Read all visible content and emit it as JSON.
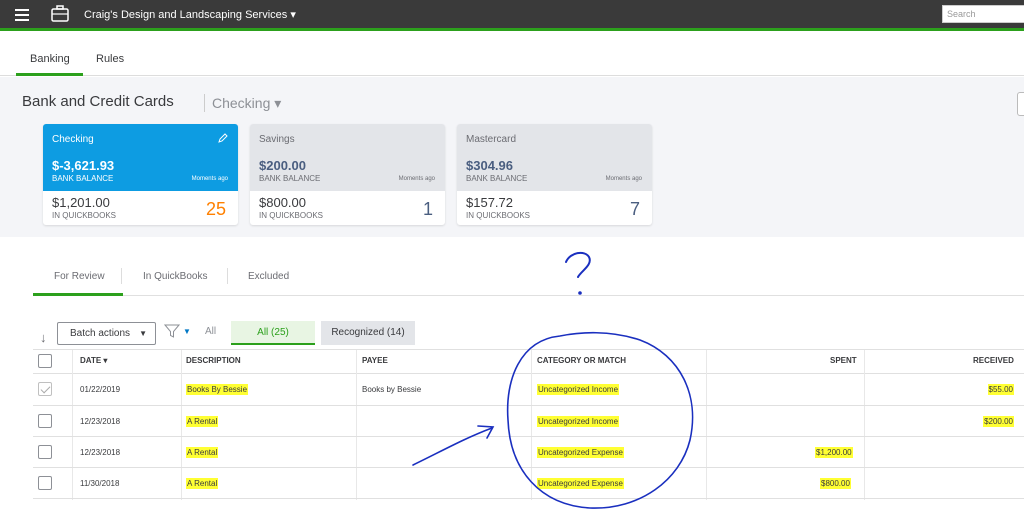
{
  "topbar": {
    "company": "Craig's Design and Landscaping Services ▾",
    "search_placeholder": "Search"
  },
  "subtabs": [
    {
      "label": "Banking"
    },
    {
      "label": "Rules"
    }
  ],
  "page": {
    "title": "Bank and Credit Cards",
    "account": "Checking ▾"
  },
  "cards": [
    {
      "name": "Checking",
      "bank_balance": "$-3,621.93",
      "bank_label": "BANK BALANCE",
      "moments": "Moments ago",
      "qb_balance": "$1,201.00",
      "qb_label": "IN QUICKBOOKS",
      "count": "25"
    },
    {
      "name": "Savings",
      "bank_balance": "$200.00",
      "bank_label": "BANK BALANCE",
      "moments": "Moments ago",
      "qb_balance": "$800.00",
      "qb_label": "IN QUICKBOOKS",
      "count": "1"
    },
    {
      "name": "Mastercard",
      "bank_balance": "$304.96",
      "bank_label": "BANK BALANCE",
      "moments": "Moments ago",
      "qb_balance": "$157.72",
      "qb_label": "IN QUICKBOOKS",
      "count": "7"
    }
  ],
  "review_tabs": [
    {
      "label": "For Review"
    },
    {
      "label": "In QuickBooks"
    },
    {
      "label": "Excluded"
    }
  ],
  "toolbar": {
    "batch_label": "Batch actions",
    "all_label": "All",
    "all_pill": "All (25)",
    "recognized_pill": "Recognized (14)"
  },
  "table": {
    "headers": {
      "date": "DATE ▾",
      "description": "DESCRIPTION",
      "payee": "PAYEE",
      "category": "CATEGORY OR MATCH",
      "spent": "SPENT",
      "received": "RECEIVED"
    },
    "rows": [
      {
        "date": "01/22/2019",
        "description": "Books By Bessie",
        "payee": "Books by Bessie",
        "category": "Uncategorized Income",
        "spent": "",
        "received": "$55.00"
      },
      {
        "date": "12/23/2018",
        "description": "A Rental",
        "payee": "",
        "category": "Uncategorized Income",
        "spent": "",
        "received": "$200.00"
      },
      {
        "date": "12/23/2018",
        "description": "A Rental",
        "payee": "",
        "category": "Uncategorized Expense",
        "spent": "$1,200.00",
        "received": ""
      },
      {
        "date": "11/30/2018",
        "description": "A Rental",
        "payee": "",
        "category": "Uncategorized Expense",
        "spent": "$800.00",
        "received": ""
      }
    ]
  },
  "colors": {
    "green": "#2ca01c",
    "blue": "#0d9ce2",
    "orange": "#ff8000",
    "highlight": "#ffff33",
    "ink": "#1a2fbf"
  }
}
